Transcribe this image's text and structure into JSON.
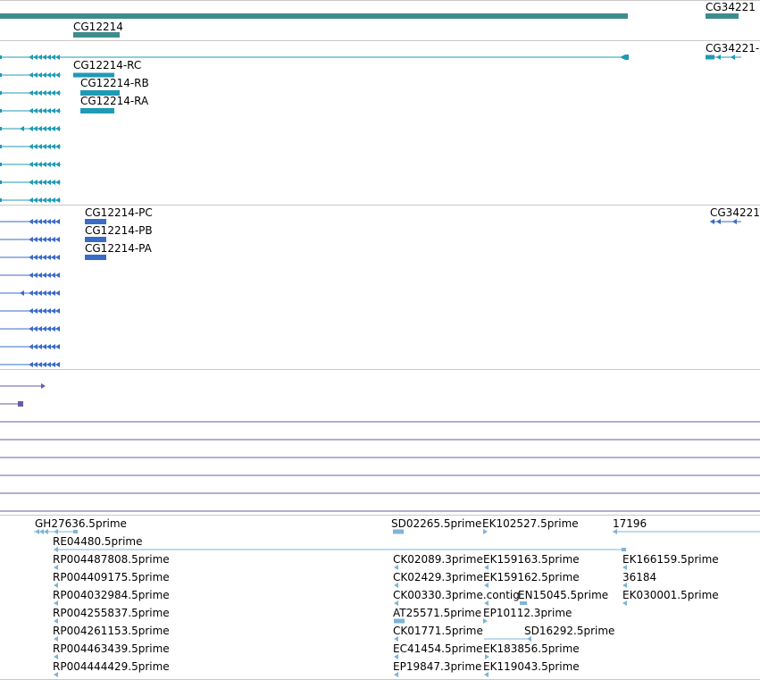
{
  "colors": {
    "gene": "#3f8c8c",
    "mrna": "#1f9ab5",
    "protein": "#3a6bc6",
    "purple": "#6a5aa8",
    "est": "#7fb4d6",
    "separator": "#c8c8c8"
  },
  "gene_track": {
    "labels": [
      "CG12214",
      "CG34221"
    ]
  },
  "mrna_track": {
    "labels": [
      "CG12214-RC",
      "CG12214-RB",
      "CG12214-RA",
      "CG34221-"
    ]
  },
  "protein_track": {
    "labels": [
      "CG12214-PC",
      "CG12214-PB",
      "CG12214-PA",
      "CG34221"
    ]
  },
  "est_track": {
    "labels": [
      "GH27636.5prime",
      "RE04480.5prime",
      "RP004487808.5prime",
      "RP004409175.5prime",
      "RP004032984.5prime",
      "RP004255837.5prime",
      "RP004261153.5prime",
      "RP004463439.5prime",
      "RP004444429.5prime",
      "SD02265.5prime",
      "EK102527.5prime",
      "17196",
      "CK02089.3prime",
      "EK159163.5prime",
      "EK166159.5prime",
      "CK02429.3prime",
      "EK159162.5prime",
      "36184",
      "CK00330.3prime.contig",
      "EN15045.5prime",
      "EK030001.5prime",
      "AT25571.5prime",
      "EP10112.3prime",
      "CK01771.5prime",
      "SD16292.5prime",
      "EC41454.5prime",
      "EK183856.5prime",
      "EP19847.3prime",
      "EK119043.5prime"
    ]
  }
}
